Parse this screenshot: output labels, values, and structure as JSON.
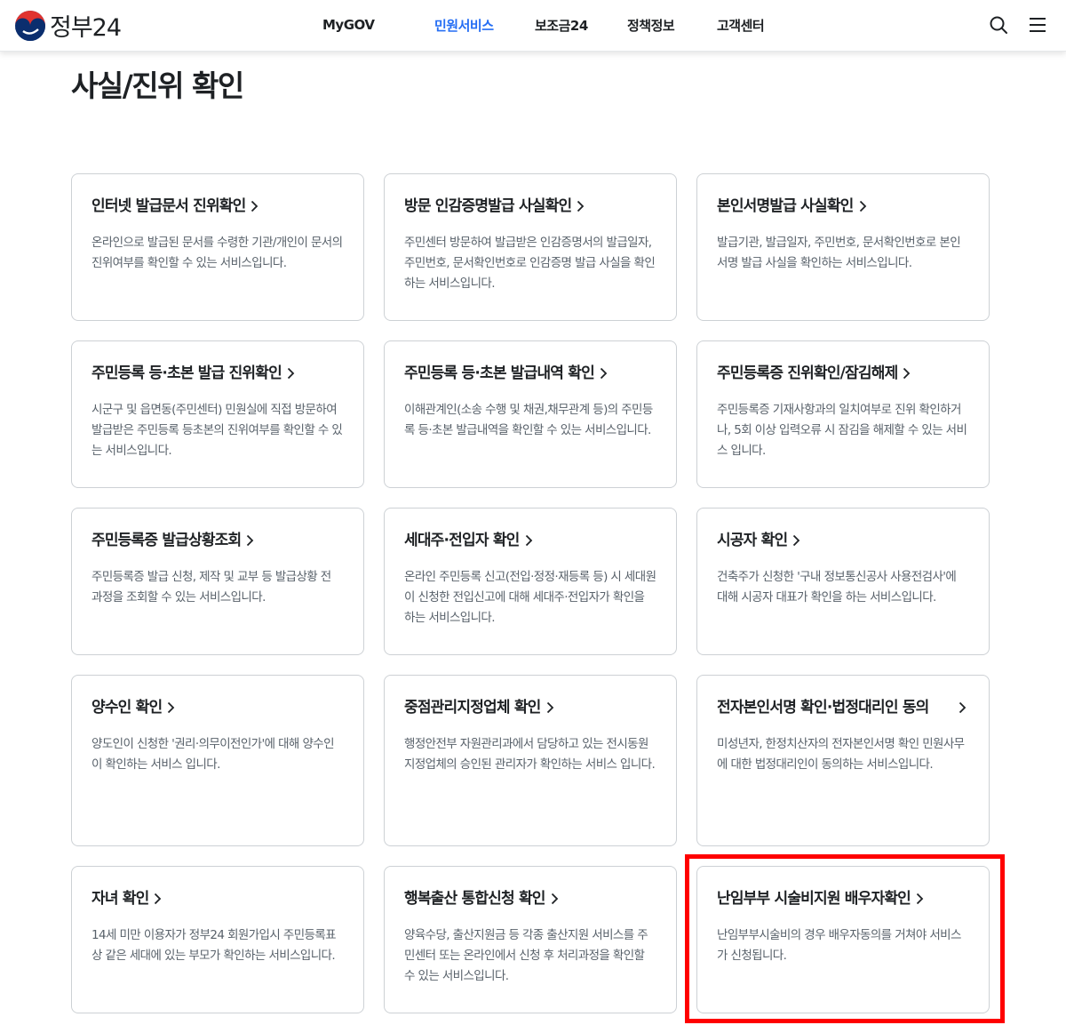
{
  "header": {
    "logo_text": "정부24",
    "nav": [
      {
        "label": "MyGOV",
        "active": false
      },
      {
        "label": "민원서비스",
        "active": true
      },
      {
        "label": "보조금24",
        "active": false
      },
      {
        "label": "정책정보",
        "active": false
      },
      {
        "label": "고객센터",
        "active": false
      }
    ]
  },
  "page_title": "사실/진위 확인",
  "cards": [
    {
      "title": "인터넷 발급문서 진위확인",
      "desc": "온라인으로 발급된 문서를 수령한 기관/개인이 문서의 진위여부를 확인할 수 있는 서비스입니다."
    },
    {
      "title": "방문 인감증명발급 사실확인",
      "desc": "주민센터 방문하여 발급받은 인감증명서의 발급일자, 주민번호, 문서확인번호로 인감증명 발급 사실을 확인하는 서비스입니다."
    },
    {
      "title": "본인서명발급 사실확인",
      "desc": "발급기관, 발급일자, 주민번호, 문서확인번호로 본인서명 발급 사실을 확인하는 서비스입니다."
    },
    {
      "title": "주민등록 등·초본 발급 진위확인",
      "desc": "시군구 및 읍면동(주민센터) 민원실에 직접 방문하여 발급받은 주민등록 등초본의 진위여부를 확인할 수 있는 서비스입니다."
    },
    {
      "title": "주민등록 등·초본 발급내역 확인",
      "desc": "이해관계인(소송 수행 및 채권,채무관계 등)의 주민등록 등·초본 발급내역을 확인할 수 있는 서비스입니다."
    },
    {
      "title": "주민등록증 진위확인/잠김해제",
      "desc": "주민등록증 기재사항과의 일치여부로 진위 확인하거나, 5회 이상 입력오류 시 잠김을 해제할 수 있는 서비스 입니다."
    },
    {
      "title": "주민등록증 발급상황조회",
      "desc": "주민등록증 발급 신청, 제작 및 교부 등 발급상황 전 과정을 조회할 수 있는 서비스입니다."
    },
    {
      "title": "세대주·전입자 확인",
      "desc": "온라인 주민등록 신고(전입·정정·재등록 등) 시 세대원이 신청한 전입신고에 대해 세대주·전입자가 확인을 하는 서비스입니다."
    },
    {
      "title": "시공자 확인",
      "desc": "건축주가 신청한 '구내 정보통신공사 사용전검사'에 대해 시공자 대표가 확인을 하는 서비스입니다."
    },
    {
      "title": "양수인 확인",
      "desc": "양도인이 신청한 '권리·의무이전인가'에 대해 양수인이 확인하는 서비스 입니다."
    },
    {
      "title": "중점관리지정업체 확인",
      "desc": "행정안전부 자원관리과에서 담당하고 있는 전시동원 지정업체의 승인된 관리자가 확인하는 서비스 입니다."
    },
    {
      "title": "전자본인서명 확인·법정대리인 동의",
      "desc": "미성년자, 한정치산자의 전자본인서명 확인 민원사무에 대한 법정대리인이 동의하는 서비스입니다."
    },
    {
      "title": "자녀 확인",
      "desc": "14세 미만 이용자가 정부24 회원가입시 주민등록표상 같은 세대에 있는 부모가 확인하는 서비스입니다."
    },
    {
      "title": "행복출산 통합신청 확인",
      "desc": "양육수당, 출산지원금 등 각종 출산지원 서비스를 주민센터 또는 온라인에서 신청 후 처리과정을 확인할 수 있는 서비스입니다."
    },
    {
      "title": "난임부부 시술비지원 배우자확인",
      "desc": "난임부부시술비의 경우 배우자동의를 거쳐야 서비스가 신청됩니다."
    }
  ],
  "colors": {
    "accent": "#256ef4",
    "highlight": "#ff0000",
    "card_border": "#cdd1d5",
    "desc_text": "#58616a"
  }
}
